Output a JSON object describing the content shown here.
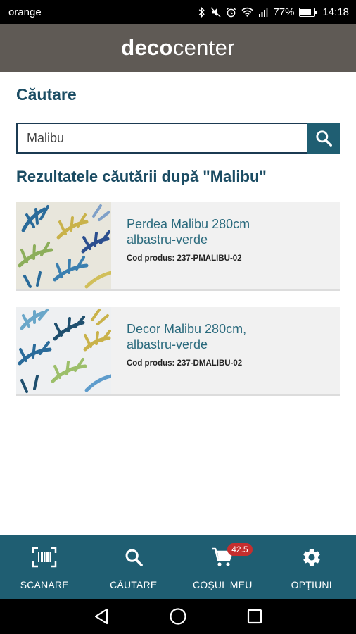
{
  "status_bar": {
    "carrier": "orange",
    "battery": "77%",
    "time": "14:18"
  },
  "header": {
    "logo_bold": "deco",
    "logo_regular": "center"
  },
  "search": {
    "title": "Căutare",
    "value": "Malibu",
    "results_title": "Rezultatele căutării după \"Malibu\""
  },
  "results": [
    {
      "name": "Perdea Malibu 280cm albastru-verde",
      "code": "Cod produs: 237-PMALIBU-02"
    },
    {
      "name": "Decor Malibu 280cm, albastru-verde",
      "code": "Cod produs: 237-DMALIBU-02"
    }
  ],
  "bottom_nav": {
    "scan": "SCANARE",
    "search": "CĂUTARE",
    "cart": "COȘUL MEU",
    "cart_badge": "42.5",
    "options": "OPȚIUNI"
  },
  "colors": {
    "header_bg": "#5f5a55",
    "accent": "#1f5e72",
    "title": "#1b4c63",
    "badge": "#c62e2e"
  }
}
